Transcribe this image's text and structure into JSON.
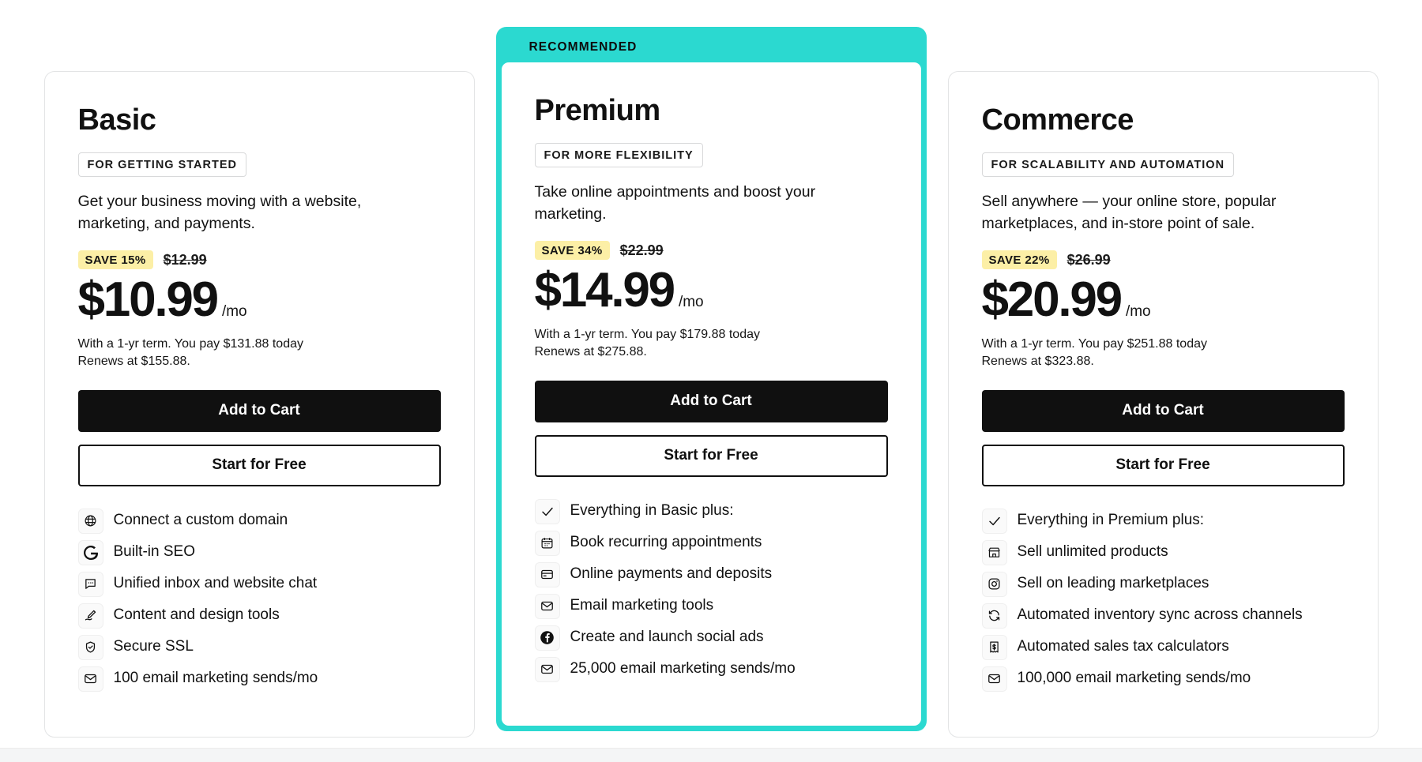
{
  "recommended_label": "RECOMMENDED",
  "accent_color": "#2BD9D0",
  "save_badge_color": "#FCEFA6",
  "plans": [
    {
      "name": "Basic",
      "tagline": "FOR GETTING STARTED",
      "description": "Get your business moving with a website, marketing, and payments.",
      "save_badge": "SAVE 15%",
      "old_price": "$12.99",
      "price": "$10.99",
      "per": "/mo",
      "term_line": "With a 1-yr term. You pay $131.88 today",
      "renew_line": "Renews at $155.88.",
      "primary_button": "Add to Cart",
      "secondary_button": "Start for Free",
      "features": [
        {
          "icon": "globe-icon",
          "label": "Connect a custom domain"
        },
        {
          "icon": "google-g-icon",
          "label": "Built-in SEO"
        },
        {
          "icon": "chat-bubble-icon",
          "label": "Unified inbox and website chat"
        },
        {
          "icon": "pen-design-icon",
          "label": "Content and design tools"
        },
        {
          "icon": "shield-check-icon",
          "label": "Secure SSL"
        },
        {
          "icon": "envelope-icon",
          "label": "100 email marketing sends/mo"
        }
      ]
    },
    {
      "name": "Premium",
      "tagline": "FOR MORE FLEXIBILITY",
      "description": "Take online appointments and boost your marketing.",
      "save_badge": "SAVE 34%",
      "old_price": "$22.99",
      "price": "$14.99",
      "per": "/mo",
      "term_line": "With a 1-yr term. You pay $179.88 today",
      "renew_line": "Renews at $275.88.",
      "primary_button": "Add to Cart",
      "secondary_button": "Start for Free",
      "features": [
        {
          "icon": "check-icon",
          "label": "Everything in Basic plus:"
        },
        {
          "icon": "calendar-icon",
          "label": "Book recurring appointments"
        },
        {
          "icon": "credit-card-icon",
          "label": "Online payments and deposits"
        },
        {
          "icon": "envelope-icon",
          "label": "Email marketing tools"
        },
        {
          "icon": "facebook-icon",
          "label": "Create and launch social ads"
        },
        {
          "icon": "envelope-icon",
          "label": "25,000 email marketing sends/mo"
        }
      ]
    },
    {
      "name": "Commerce",
      "tagline": "FOR SCALABILITY AND AUTOMATION",
      "description": "Sell anywhere — your online store, popular marketplaces, and in-store point of sale.",
      "save_badge": "SAVE 22%",
      "old_price": "$26.99",
      "price": "$20.99",
      "per": "/mo",
      "term_line": "With a 1-yr term. You pay $251.88 today",
      "renew_line": "Renews at $323.88.",
      "primary_button": "Add to Cart",
      "secondary_button": "Start for Free",
      "features": [
        {
          "icon": "check-icon",
          "label": "Everything in Premium plus:"
        },
        {
          "icon": "storefront-icon",
          "label": "Sell unlimited products"
        },
        {
          "icon": "instagram-icon",
          "label": "Sell on leading marketplaces"
        },
        {
          "icon": "sync-icon",
          "label": "Automated inventory sync across channels"
        },
        {
          "icon": "tax-receipt-icon",
          "label": "Automated sales tax calculators"
        },
        {
          "icon": "envelope-icon",
          "label": "100,000 email marketing sends/mo"
        }
      ]
    }
  ]
}
